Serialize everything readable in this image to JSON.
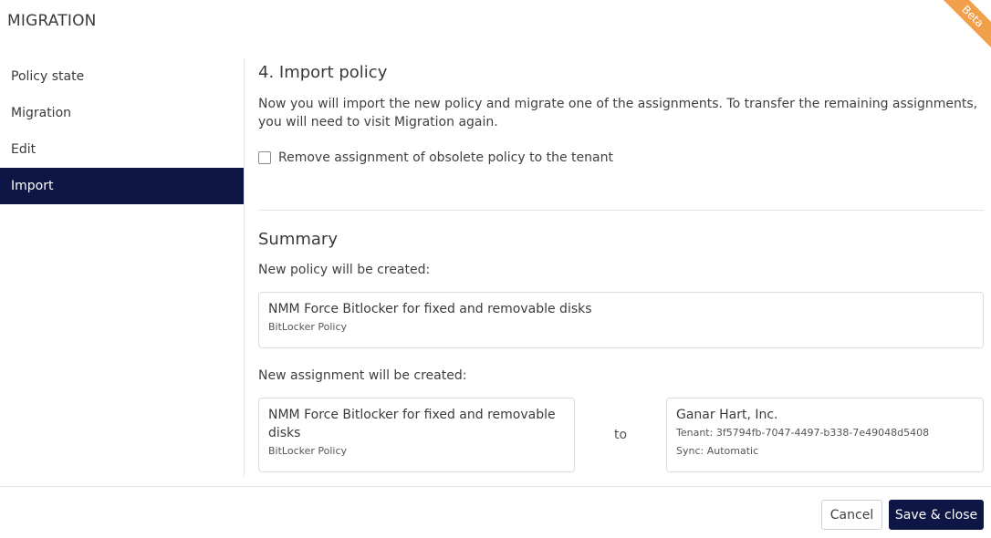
{
  "header": {
    "title": "MIGRATION",
    "badge": "Beta"
  },
  "sidebar": {
    "items": [
      {
        "label": "Policy state"
      },
      {
        "label": "Migration"
      },
      {
        "label": "Edit"
      },
      {
        "label": "Import"
      }
    ],
    "active": "Import"
  },
  "main": {
    "step_title": "4. Import policy",
    "description": "Now you will import the new policy and migrate one of the assignments. To transfer the remaining assignments, you will need to visit Migration again.",
    "remove_assignment": {
      "label": "Remove assignment of obsolete policy to the tenant",
      "checked": false
    },
    "summary": {
      "title": "Summary",
      "new_policy_label": "New policy will be created:",
      "new_policy": {
        "name": "NMM Force Bitlocker for fixed and removable disks",
        "type": "BitLocker Policy"
      },
      "new_assignment_label": "New assignment will be created:",
      "assignment_policy": {
        "name": "NMM Force Bitlocker for fixed and removable disks",
        "type": "BitLocker Policy"
      },
      "to_label": "to",
      "tenant": {
        "name": "Ganar Hart, Inc.",
        "tenant_line": "Tenant: 3f5794fb-7047-4497-b338-7e49048d5408",
        "sync_line": "Sync: Automatic"
      }
    }
  },
  "footer": {
    "cancel_label": "Cancel",
    "save_label": "Save & close"
  },
  "colors": {
    "primary": "#0d1645",
    "badge": "#f0a04b",
    "border": "#dcdcdc"
  }
}
